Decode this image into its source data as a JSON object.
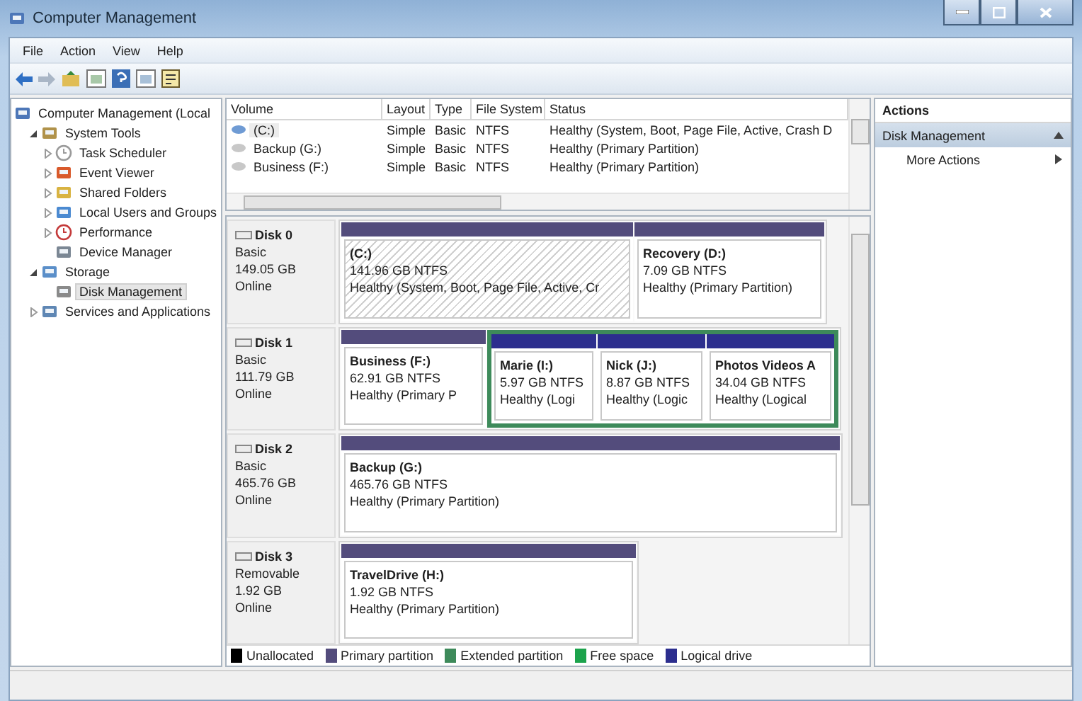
{
  "window": {
    "title": "Computer Management"
  },
  "menu": [
    "File",
    "Action",
    "View",
    "Help"
  ],
  "tree": [
    {
      "label": "Computer Management (Local",
      "selected": false,
      "children": [
        {
          "label": "System Tools",
          "selected": false,
          "expanded": true,
          "children": [
            {
              "label": "Task Scheduler",
              "selected": false,
              "expanded": false
            },
            {
              "label": "Event Viewer",
              "selected": false,
              "expanded": false
            },
            {
              "label": "Shared Folders",
              "selected": false,
              "expanded": false
            },
            {
              "label": "Local Users and Groups",
              "selected": false,
              "expanded": false
            },
            {
              "label": "Performance",
              "selected": false,
              "expanded": false
            },
            {
              "label": "Device Manager",
              "selected": false
            }
          ]
        },
        {
          "label": "Storage",
          "selected": false,
          "expanded": true,
          "children": [
            {
              "label": "Disk Management",
              "selected": true
            }
          ]
        },
        {
          "label": "Services and Applications",
          "selected": false,
          "expanded": false
        }
      ]
    }
  ],
  "volumes": {
    "columns": [
      "Volume",
      "Layout",
      "Type",
      "File System",
      "Status"
    ],
    "rows": [
      {
        "cells": [
          "(C:)",
          "Simple",
          "Basic",
          "NTFS",
          "Healthy (System, Boot, Page File, Active, Crash D"
        ],
        "selected": true
      },
      {
        "cells": [
          "Backup (G:)",
          "Simple",
          "Basic",
          "NTFS",
          "Healthy (Primary Partition)"
        ],
        "selected": false
      },
      {
        "cells": [
          "Business (F:)",
          "Simple",
          "Basic",
          "NTFS",
          "Healthy (Primary Partition)"
        ],
        "selected": false
      }
    ]
  },
  "disks": [
    {
      "name": "Disk 0",
      "type": "Basic",
      "size": "149.05 GB",
      "state": "Online",
      "partitions": [
        {
          "kind": "primary",
          "name": "(C:)",
          "fs": "141.96 GB NTFS",
          "status": "Healthy (System, Boot, Page File, Active, Cr",
          "selected": true
        },
        {
          "kind": "primary",
          "name": "Recovery  (D:)",
          "fs": "7.09 GB NTFS",
          "status": "Healthy (Primary Partition)",
          "selected": false
        }
      ]
    },
    {
      "name": "Disk 1",
      "type": "Basic",
      "size": "111.79 GB",
      "state": "Online",
      "partitions": [
        {
          "kind": "primary",
          "name": "Business  (F:)",
          "fs": "62.91 GB NTFS",
          "status": "Healthy (Primary P",
          "selected": false
        },
        {
          "kind": "extended",
          "children": [
            {
              "kind": "logical",
              "name": "Marie  (I:)",
              "fs": "5.97 GB NTFS",
              "status": "Healthy (Logi",
              "selected": false
            },
            {
              "kind": "logical",
              "name": "Nick  (J:)",
              "fs": "8.87 GB NTFS",
              "status": "Healthy (Logic",
              "selected": false
            },
            {
              "kind": "logical",
              "name": "Photos Videos A",
              "fs": "34.04 GB NTFS",
              "status": "Healthy (Logical",
              "selected": false
            }
          ]
        }
      ]
    },
    {
      "name": "Disk 2",
      "type": "Basic",
      "size": "465.76 GB",
      "state": "Online",
      "partitions": [
        {
          "kind": "primary",
          "name": "Backup  (G:)",
          "fs": "465.76 GB NTFS",
          "status": "Healthy (Primary Partition)",
          "selected": false
        }
      ]
    },
    {
      "name": "Disk 3",
      "type": "Removable",
      "size": "1.92 GB",
      "state": "Online",
      "partitions": [
        {
          "kind": "primary",
          "name": "TravelDrive  (H:)",
          "fs": "1.92 GB NTFS",
          "status": "Healthy (Primary Partition)",
          "selected": false
        }
      ]
    }
  ],
  "legend": [
    {
      "label": "Unallocated",
      "color": "#000000"
    },
    {
      "label": "Primary partition",
      "color": "#534c7c"
    },
    {
      "label": "Extended partition",
      "color": "#3d8a5a"
    },
    {
      "label": "Free space",
      "color": "#1ca34c"
    },
    {
      "label": "Logical drive",
      "color": "#2c2e8e"
    }
  ],
  "actions": {
    "title": "Actions",
    "sections": [
      {
        "label": "Disk Management",
        "expanded": true,
        "items": [
          "More Actions"
        ]
      }
    ]
  }
}
